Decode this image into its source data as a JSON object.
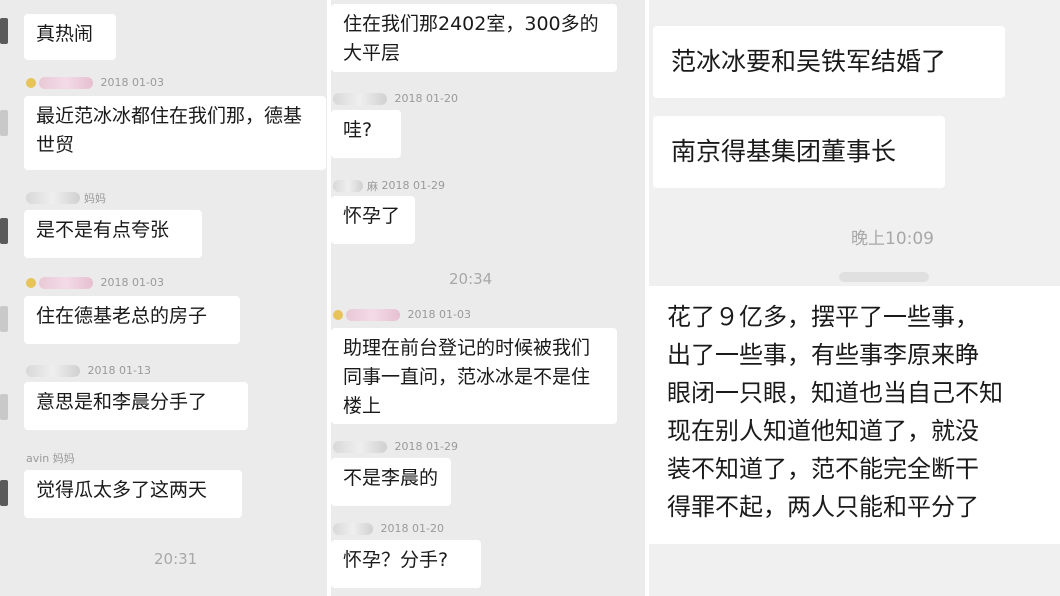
{
  "panel1": {
    "messages": [
      {
        "text": "真热闹"
      },
      {
        "date": "2018",
        "date2": "01-03",
        "text": "最近范冰冰都住在我们那，德基世贸"
      },
      {
        "name": "妈妈",
        "text": "是不是有点夸张"
      },
      {
        "date": "2018",
        "date2": "01-03",
        "text": "住在德基老总的房子"
      },
      {
        "date": "2018",
        "date2": "01-13",
        "text": "意思是和李晨分手了"
      },
      {
        "name": "avin 妈妈",
        "text": "觉得瓜太多了这两天"
      }
    ],
    "time": "20:31"
  },
  "panel2": {
    "messages": [
      {
        "text": "住在我们那2402室，300多的大平层"
      },
      {
        "date": "2018",
        "date2": "01-20",
        "text": "哇?"
      },
      {
        "name": "麻",
        "date": "2018",
        "date2": "01-29",
        "text": "怀孕了"
      },
      {
        "date": "2018",
        "date2": "01-03",
        "text": "助理在前台登记的时候被我们同事一直问，范冰冰是不是住楼上"
      },
      {
        "date": "2018",
        "date2": "01-29",
        "text": "不是李晨的"
      },
      {
        "date": "2018",
        "date2": "01-20",
        "text": "怀孕？分手?"
      }
    ],
    "time": "20:34"
  },
  "panel3": {
    "messages": [
      {
        "text": "范冰冰要和吴铁军结婚了"
      },
      {
        "text": "南京得基集团董事长"
      }
    ],
    "time": "晚上10:09",
    "big_lines": [
      "花了９亿多，摆平了一些事，",
      "出了一些事，有些事李原来睁",
      "眼闭一只眼，知道也当自己不知",
      "现在别人知道他知道了，就没",
      "装不知道了，范不能完全断干",
      "得罪不起，两人只能和平分了"
    ]
  }
}
